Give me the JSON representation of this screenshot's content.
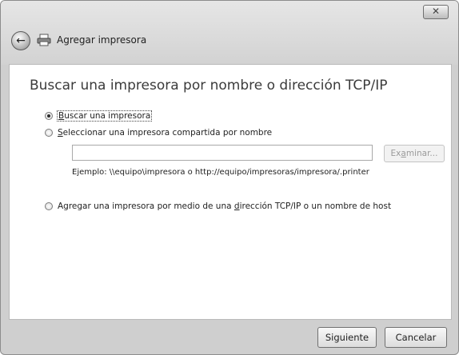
{
  "window": {
    "title": "Agregar impresora",
    "close_glyph": "✕"
  },
  "content": {
    "heading": "Buscar una impresora por nombre o dirección TCP/IP",
    "options": [
      {
        "key": "B",
        "rest": "uscar una impresora",
        "checked": true
      },
      {
        "key": "S",
        "rest": "eleccionar una impresora compartida por nombre",
        "checked": false
      },
      {
        "pre": "Agregar una impresora por medio de una ",
        "key": "d",
        "rest": "irección TCP/IP o un nombre de host",
        "checked": false
      }
    ],
    "shared_name_value": "",
    "browse_pre": "Ex",
    "browse_key": "a",
    "browse_post": "minar...",
    "example": "Ejemplo: \\\\equipo\\impresora o http://equipo/impresoras/impresora/.printer"
  },
  "footer": {
    "next_label": "Siguiente",
    "cancel_label": "Cancelar"
  },
  "icons": [
    "close-icon",
    "back-arrow-icon",
    "printer-icon"
  ]
}
